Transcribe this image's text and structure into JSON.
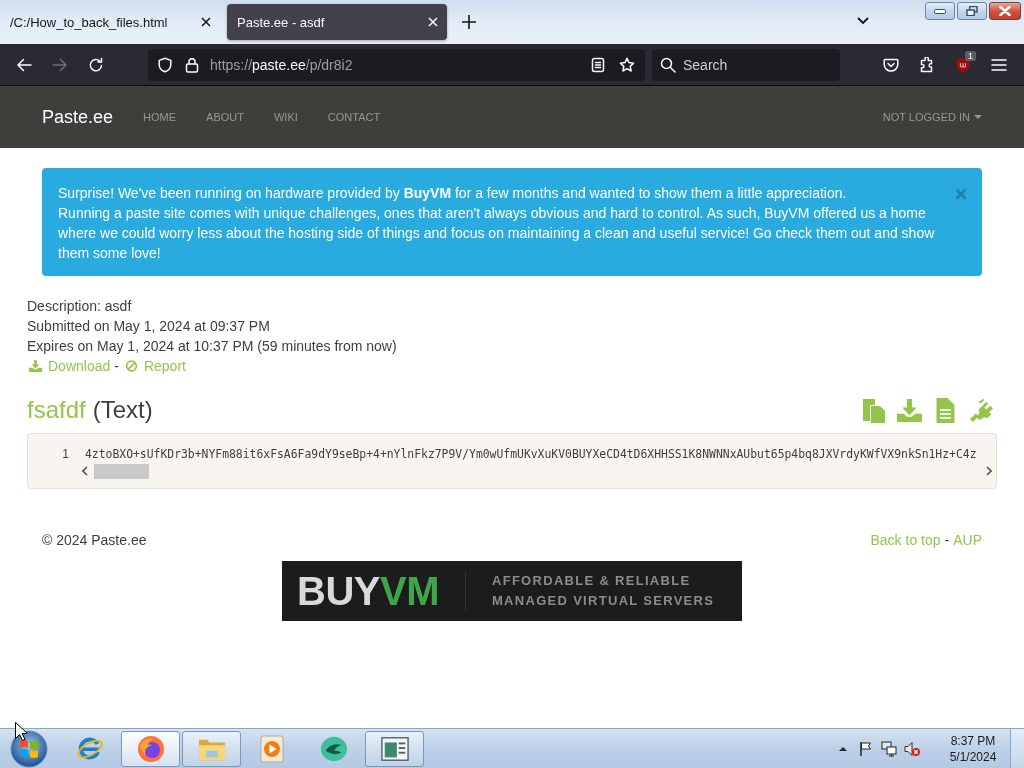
{
  "browser": {
    "tabs": [
      {
        "title": "/C:/How_to_back_files.html",
        "selected": false
      },
      {
        "title": "Paste.ee - asdf",
        "selected": true
      }
    ],
    "nav_buttons": [
      {
        "kind": "back",
        "disabled": false
      },
      {
        "kind": "forward",
        "disabled": true
      },
      {
        "kind": "reload",
        "disabled": false
      }
    ],
    "address": {
      "scheme": "https://",
      "host": "paste.ee",
      "path": "/p/dr8i2"
    },
    "search": {
      "placeholder": "Search"
    },
    "extension_badge": "1"
  },
  "navbar": {
    "brand": "Paste.ee",
    "links": [
      "HOME",
      "ABOUT",
      "WIKI",
      "CONTACT"
    ],
    "account_menu": "NOT LOGGED IN"
  },
  "alert": {
    "paragraphs": [
      "Surprise! We've been running on hardware provided by **BuyVM** for a few months and wanted to show them a little appreciation.",
      "Running a paste site comes with unique challenges, ones that aren't always obvious and hard to control. As such, BuyVM offered us a home where we could worry less about the hosting side of things and focus on maintaining a clean and useful service! Go check them out and show them some love!"
    ]
  },
  "paste": {
    "details": [
      "Description: asdf",
      "Submitted on May 1, 2024 at 09:37 PM",
      "Expires on May 1, 2024 at 10:37 PM (59 minutes from now)"
    ],
    "actions": [
      {
        "kind": "download",
        "label": "Download"
      },
      {
        "kind": "report",
        "label": "Report"
      }
    ],
    "action_separator": "-",
    "title": "fsafdf",
    "language": "(Text)",
    "code_lines": [
      {
        "number": "1",
        "text": "4ztoBXO+sUfKDr3b+NYFm88it6xFsA6Fa9dY9seBp+4+nYlnFkz7P9V/Ym0wUfmUKvXuKV0BUYXeCD4tD6XHHSS1K8NWNNxAUbut65p4bq8JXVrdyKWfVX9nkSn1Hz+C4z"
      }
    ]
  },
  "footer": {
    "copyright": "© 2024 Paste.ee",
    "links": [
      "Back to top",
      "AUP"
    ],
    "separator": "-"
  },
  "banner": {
    "logo_main": "BUY",
    "logo_accent": "VM",
    "tagline": [
      "AFFORDABLE & RELIABLE",
      "MANAGED VIRTUAL SERVERS"
    ]
  },
  "taskbar": {
    "apps": [
      {
        "kind": "e-globe",
        "running": false,
        "selected": false
      },
      {
        "kind": "fox-globe",
        "running": true,
        "selected": true
      },
      {
        "kind": "folder",
        "running": true,
        "selected": false
      },
      {
        "kind": "play",
        "running": false,
        "selected": false
      },
      {
        "kind": "sphere",
        "running": false,
        "selected": false
      },
      {
        "kind": "window",
        "running": true,
        "selected": false
      }
    ],
    "tray": {
      "volume_muted": true
    },
    "clock": {
      "time": "8:37 PM",
      "date": "5/1/2024"
    }
  }
}
